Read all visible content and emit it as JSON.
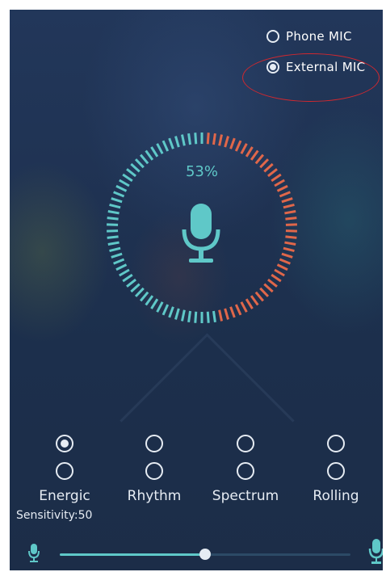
{
  "mic_source": {
    "options": [
      {
        "label": "Phone MIC",
        "checked": false
      },
      {
        "label": "External MIC",
        "checked": true
      }
    ]
  },
  "gauge": {
    "percent_label": "53%",
    "level": 0.53,
    "colors": {
      "active": "#5fc8c8",
      "inactive": "#e0674a"
    }
  },
  "modes": {
    "columns": [
      {
        "label": "Energic",
        "row1_checked": true,
        "row2_checked": false
      },
      {
        "label": "Rhythm",
        "row1_checked": false,
        "row2_checked": false
      },
      {
        "label": "Spectrum",
        "row1_checked": false,
        "row2_checked": false
      },
      {
        "label": "Rolling",
        "row1_checked": false,
        "row2_checked": false
      }
    ]
  },
  "sensitivity": {
    "label": "Sensitivity:50",
    "value": 50,
    "max": 100
  },
  "icons": {
    "center": "microphone-icon",
    "slider_min": "microphone-small-icon",
    "slider_max": "microphone-large-icon"
  },
  "colors": {
    "accent": "#5fc8c8",
    "warning": "#e0674a",
    "annotation": "#d0282f"
  }
}
